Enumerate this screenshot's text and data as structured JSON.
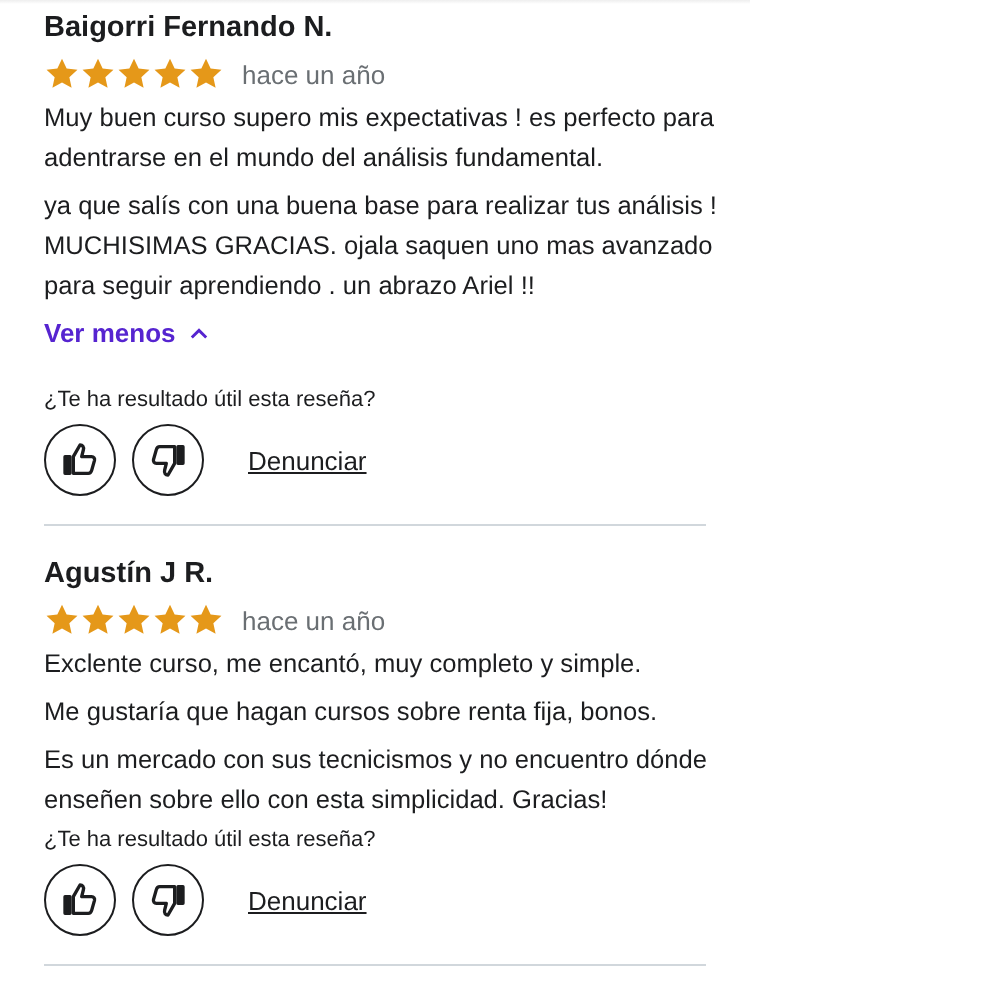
{
  "reviews": [
    {
      "author": "Baigorri Fernando N.",
      "stars": 5,
      "date": "hace un año",
      "paragraphs": [
        "Muy buen curso supero mis expectativas ! es perfecto para adentrarse en el mundo del análisis fundamental.",
        "ya que salís con una buena base para realizar tus análisis ! MUCHISIMAS GRACIAS. ojala saquen uno mas avanzado para seguir aprendiendo . un abrazo Ariel !!"
      ],
      "toggle": "Ver menos",
      "helpful_question": "¿Te ha resultado útil esta reseña?",
      "report": "Denunciar"
    },
    {
      "author": "Agustín J R.",
      "stars": 5,
      "date": "hace un año",
      "paragraphs": [
        "Exclente curso, me encantó, muy completo y simple.",
        "Me gustaría que hagan cursos sobre renta fija, bonos.",
        "Es un mercado con sus tecnicismos y no encuentro dónde enseñen sobre ello con esta simplicidad. Gracias!"
      ],
      "helpful_question": "¿Te ha resultado útil esta reseña?",
      "report": "Denunciar"
    }
  ]
}
